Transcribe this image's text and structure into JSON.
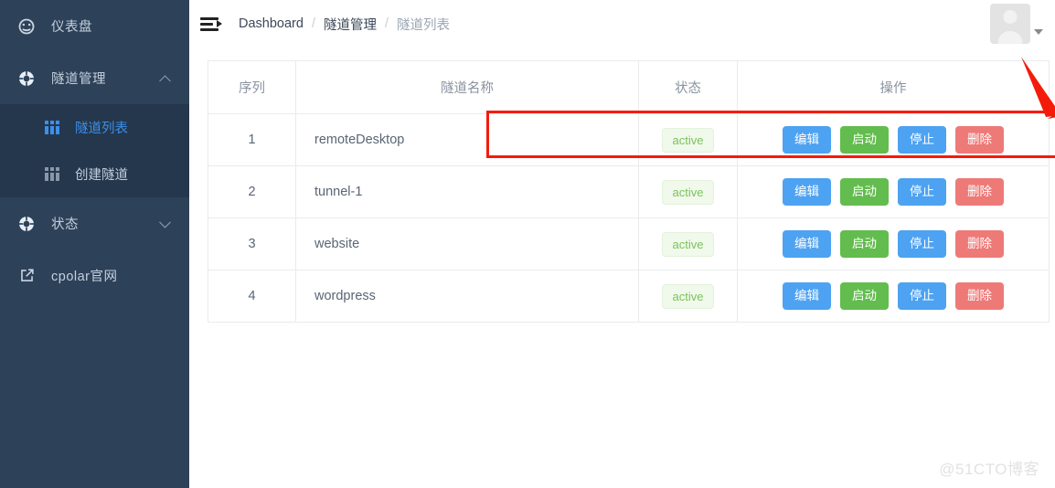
{
  "sidebar": {
    "bg_color": "#2d4159",
    "submenu_bg_color": "#25374d",
    "active_color": "#3d8fe8",
    "items": [
      {
        "label": "仪表盘",
        "icon": "dashboard-gauge-icon",
        "expandable": false
      },
      {
        "label": "隧道管理",
        "icon": "lifebuoy-icon",
        "expandable": true,
        "chevron": "up"
      },
      {
        "label": "状态",
        "icon": "lifebuoy-icon",
        "expandable": true,
        "chevron": "down"
      },
      {
        "label": "cpolar官网",
        "icon": "external-link-icon",
        "expandable": false
      }
    ],
    "submenu": [
      {
        "label": "隧道列表",
        "icon": "grid-table-icon",
        "active": true
      },
      {
        "label": "创建隧道",
        "icon": "grid-table-icon",
        "active": false
      }
    ]
  },
  "topbar": {
    "menu_toggle_icon": "hamburger-collapse-icon",
    "breadcrumb": [
      {
        "label": "Dashboard",
        "muted": false
      },
      {
        "label": "隧道管理",
        "muted": false
      },
      {
        "label": "隧道列表",
        "muted": true
      }
    ],
    "separator": "/",
    "avatar_icon": "user-avatar-placeholder",
    "dropdown_icon": "caret-down-icon"
  },
  "table": {
    "headers": [
      "序列",
      "隧道名称",
      "状态",
      "操作"
    ],
    "rows": [
      {
        "seq": "1",
        "name": "remoteDesktop",
        "status": "active",
        "actions": [
          "编辑",
          "启动",
          "停止",
          "删除"
        ],
        "highlighted": true
      },
      {
        "seq": "2",
        "name": "tunnel-1",
        "status": "active",
        "actions": [
          "编辑",
          "启动",
          "停止",
          "删除"
        ],
        "highlighted": false
      },
      {
        "seq": "3",
        "name": "website",
        "status": "active",
        "actions": [
          "编辑",
          "启动",
          "停止",
          "删除"
        ],
        "highlighted": false
      },
      {
        "seq": "4",
        "name": "wordpress",
        "status": "active",
        "actions": [
          "编辑",
          "启动",
          "停止",
          "删除"
        ],
        "highlighted": false
      }
    ],
    "button_colors": {
      "edit": "#4da2f2",
      "start": "#63bc4e",
      "stop": "#4da2f2",
      "delete": "#ee7a78"
    },
    "status_badge_color": "#7bc35a"
  },
  "annotation": {
    "color": "#f41b0a",
    "arrow_target": "编辑",
    "highlight_row": "remoteDesktop"
  },
  "watermark": {
    "text": "@51CTO博客"
  }
}
